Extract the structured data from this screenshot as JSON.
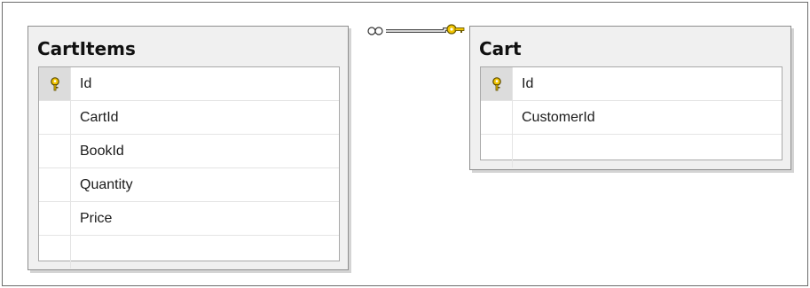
{
  "tables": [
    {
      "name": "CartItems",
      "columns": [
        {
          "name": "Id",
          "primary_key": true
        },
        {
          "name": "CartId",
          "primary_key": false
        },
        {
          "name": "BookId",
          "primary_key": false
        },
        {
          "name": "Quantity",
          "primary_key": false
        },
        {
          "name": "Price",
          "primary_key": false
        }
      ]
    },
    {
      "name": "Cart",
      "columns": [
        {
          "name": "Id",
          "primary_key": true
        },
        {
          "name": "CustomerId",
          "primary_key": false
        }
      ]
    }
  ],
  "relationship": {
    "from": "CartItems",
    "to": "Cart",
    "from_end": "many-infinity-icon",
    "to_end": "key-icon",
    "key_color": "#f2c500"
  }
}
